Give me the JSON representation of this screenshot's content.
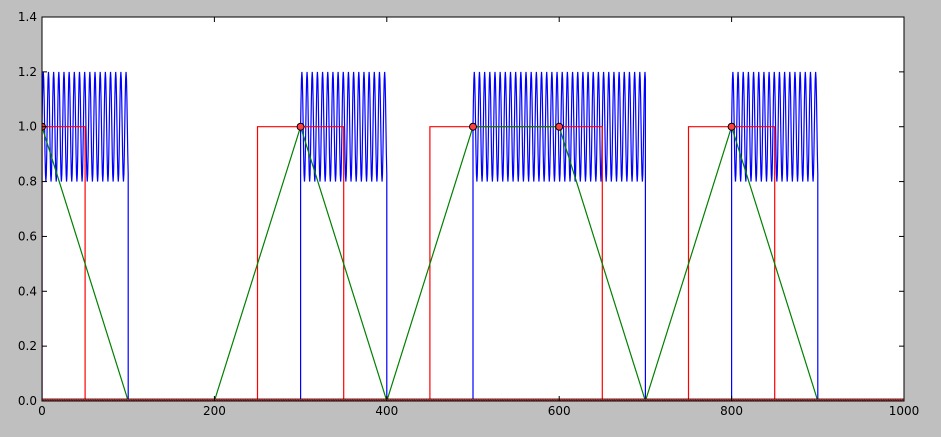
{
  "chart_data": {
    "type": "line",
    "xlim": [
      0,
      1000
    ],
    "ylim": [
      0.0,
      1.4
    ],
    "x_ticks": [
      0,
      200,
      400,
      600,
      800,
      1000
    ],
    "x_tick_labels": [
      "0",
      "200",
      "400",
      "600",
      "800",
      "1000"
    ],
    "y_ticks": [
      0.0,
      0.2,
      0.4,
      0.6,
      0.8,
      1.0,
      1.2,
      1.4
    ],
    "y_tick_labels": [
      "0.0",
      "0.2",
      "0.4",
      "0.6",
      "0.8",
      "1.0",
      "1.2",
      "1.4"
    ],
    "grid": false,
    "legend": null,
    "series": [
      {
        "color": "#0000ff",
        "kind": "oscillating_bursts",
        "baseline": 0.0,
        "burst_center": 1.0,
        "burst_amplitude": 0.2,
        "burst_period": 6,
        "bursts": [
          [
            0,
            100
          ],
          [
            300,
            400
          ],
          [
            500,
            700
          ],
          [
            800,
            900
          ]
        ]
      },
      {
        "color": "#ff0000",
        "kind": "square_pulses",
        "high": 1.0,
        "low": 0.0,
        "pulses": [
          [
            0,
            50
          ],
          [
            250,
            350
          ],
          [
            450,
            650
          ],
          [
            750,
            850
          ]
        ]
      },
      {
        "color": "#008000",
        "kind": "line",
        "x": [
          0,
          100,
          200,
          300,
          400,
          500,
          600,
          700,
          800,
          900
        ],
        "y": [
          1.0,
          0.0,
          0.0,
          1.0,
          0.0,
          1.0,
          1.0,
          0.0,
          1.0,
          0.0
        ]
      }
    ],
    "markers": {
      "fill": "#ff4040",
      "stroke": "#000000",
      "x": [
        0,
        300,
        500,
        600,
        800
      ],
      "y": [
        1.0,
        1.0,
        1.0,
        1.0,
        1.0
      ]
    },
    "baseline_markers": {
      "fill": "#ff4040",
      "y": 0.0,
      "x_range": [
        0,
        1000
      ]
    }
  }
}
